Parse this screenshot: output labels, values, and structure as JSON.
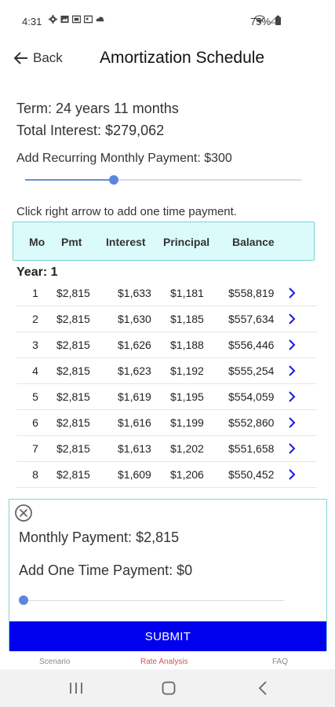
{
  "status_bar": {
    "time": "4:31",
    "battery": "75%",
    "icons_left": [
      "gear-icon",
      "image-icon",
      "screen-icon",
      "cast-icon",
      "cloud-icon"
    ],
    "icons_right": [
      "wifi-icon",
      "signal-icon",
      "battery-icon"
    ]
  },
  "header": {
    "back_label": "Back",
    "title": "Amortization Schedule"
  },
  "summary": {
    "term": "Term: 24 years 11 months",
    "total_interest": "Total Interest: $279,062",
    "recurring_label": "Add Recurring Monthly Payment: $300",
    "recurring_slider_fraction": 0.32,
    "hint": "Click right arrow to add one time payment."
  },
  "table": {
    "headers": [
      "Mo",
      "Pmt",
      "Interest",
      "Principal",
      "Balance"
    ],
    "year_label": "Year: 1",
    "rows": [
      {
        "mo": "1",
        "pmt": "$2,815",
        "interest": "$1,633",
        "principal": "$1,181",
        "balance": "$558,819"
      },
      {
        "mo": "2",
        "pmt": "$2,815",
        "interest": "$1,630",
        "principal": "$1,185",
        "balance": "$557,634"
      },
      {
        "mo": "3",
        "pmt": "$2,815",
        "interest": "$1,626",
        "principal": "$1,188",
        "balance": "$556,446"
      },
      {
        "mo": "4",
        "pmt": "$2,815",
        "interest": "$1,623",
        "principal": "$1,192",
        "balance": "$555,254"
      },
      {
        "mo": "5",
        "pmt": "$2,815",
        "interest": "$1,619",
        "principal": "$1,195",
        "balance": "$554,059"
      },
      {
        "mo": "6",
        "pmt": "$2,815",
        "interest": "$1,616",
        "principal": "$1,199",
        "balance": "$552,860"
      },
      {
        "mo": "7",
        "pmt": "$2,815",
        "interest": "$1,613",
        "principal": "$1,202",
        "balance": "$551,658"
      },
      {
        "mo": "8",
        "pmt": "$2,815",
        "interest": "$1,609",
        "principal": "$1,206",
        "balance": "$550,452"
      }
    ]
  },
  "payment_card": {
    "monthly_payment": "Monthly Payment: $2,815",
    "one_time_payment": "Add One Time Payment: $0",
    "one_time_slider_fraction": 0,
    "submit_label": "SUBMIT"
  },
  "tabs": {
    "items": [
      "Scenario",
      "Rate Analysis",
      "FAQ"
    ],
    "active": "Rate Analysis"
  },
  "colors": {
    "accent_blue": "#0000ee",
    "slider_blue": "#5b86e0",
    "table_header_bg": "#dbfbfb",
    "table_header_border": "#77d4d4",
    "active_tab": "#d45454"
  }
}
